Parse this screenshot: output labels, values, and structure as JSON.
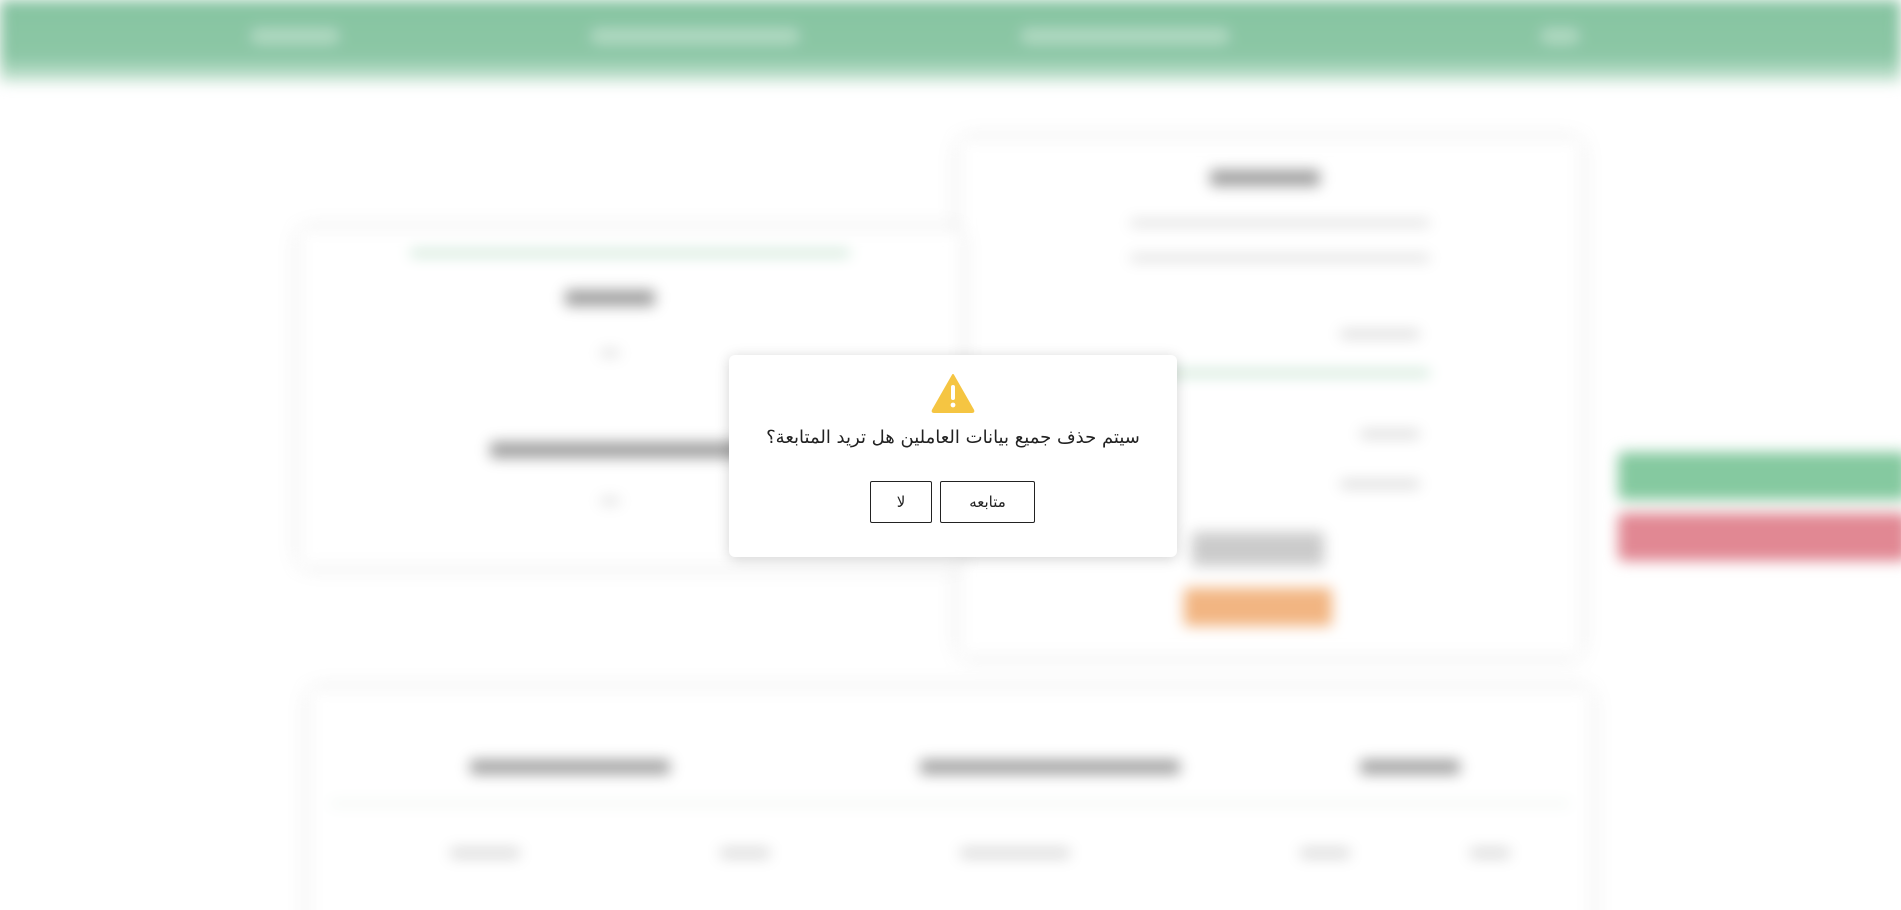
{
  "dialog": {
    "icon": "warning-icon",
    "icon_color": "#f5c542",
    "message": "سيتم حذف جميع بيانات العاملين هل تريد المتابعة؟",
    "continue_label": "متابعه",
    "no_label": "لا"
  },
  "colors": {
    "header": "#80c19d",
    "success_side_button": "#7fc79b",
    "danger_side_button": "#e0828e",
    "orange_button": "#f2b27c"
  }
}
